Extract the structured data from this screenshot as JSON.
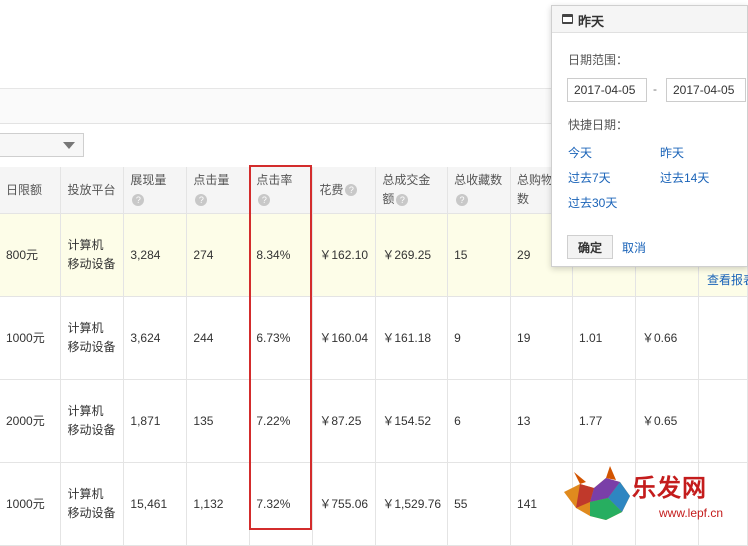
{
  "table": {
    "headers": [
      {
        "label": "日限额",
        "help": false
      },
      {
        "label": "投放平台",
        "help": false
      },
      {
        "label": "展现量",
        "help": true
      },
      {
        "label": "点击量",
        "help": true
      },
      {
        "label": "点击率",
        "help": true
      },
      {
        "label": "花费",
        "help": true
      },
      {
        "label": "总成交金额",
        "help": true
      },
      {
        "label": "总收藏数",
        "help": true
      },
      {
        "label": "总购物车数",
        "help": false
      },
      {
        "label": "",
        "help": false
      },
      {
        "label": "",
        "help": false
      },
      {
        "label": "",
        "help": false
      }
    ],
    "rows": [
      {
        "budget": "800元",
        "platform": "计算机\n移动设备",
        "impressions": "3,284",
        "clicks": "274",
        "ctr": "8.34%",
        "cost": "￥162.10",
        "gmv": "￥269.25",
        "favorites": "15",
        "carts": "29",
        "c1": "",
        "c2": "",
        "c3": ""
      },
      {
        "budget": "1000元",
        "platform": "计算机\n移动设备",
        "impressions": "3,624",
        "clicks": "244",
        "ctr": "6.73%",
        "cost": "￥160.04",
        "gmv": "￥161.18",
        "favorites": "9",
        "carts": "19",
        "c1": "1.01",
        "c2": "￥0.66",
        "c3": ""
      },
      {
        "budget": "2000元",
        "platform": "计算机\n移动设备",
        "impressions": "1,871",
        "clicks": "135",
        "ctr": "7.22%",
        "cost": "￥87.25",
        "gmv": "￥154.52",
        "favorites": "6",
        "carts": "13",
        "c1": "1.77",
        "c2": "￥0.65",
        "c3": ""
      },
      {
        "budget": "1000元",
        "platform": "计算机\n移动设备",
        "impressions": "15,461",
        "clicks": "1,132",
        "ctr": "7.32%",
        "cost": "￥755.06",
        "gmv": "￥1,529.76",
        "favorites": "55",
        "carts": "141",
        "c1": "",
        "c2": "",
        "c3": ""
      }
    ]
  },
  "report_link": "查看报表",
  "date_popup": {
    "title": "昨天",
    "range_label": "日期范围：",
    "start_date": "2017-04-05",
    "end_date": "2017-04-05",
    "separator": "-",
    "quick_label": "快捷日期：",
    "quick_options": [
      "今天",
      "昨天",
      "过去7天",
      "过去14天",
      "过去30天"
    ],
    "confirm": "确定",
    "cancel": "取消"
  },
  "watermark": {
    "brand": "乐发网",
    "url": "www.lepf.cn"
  },
  "colors": {
    "link": "#1a63b8",
    "highlight_row": "#fdfde8",
    "annotation": "#d32c2c"
  }
}
